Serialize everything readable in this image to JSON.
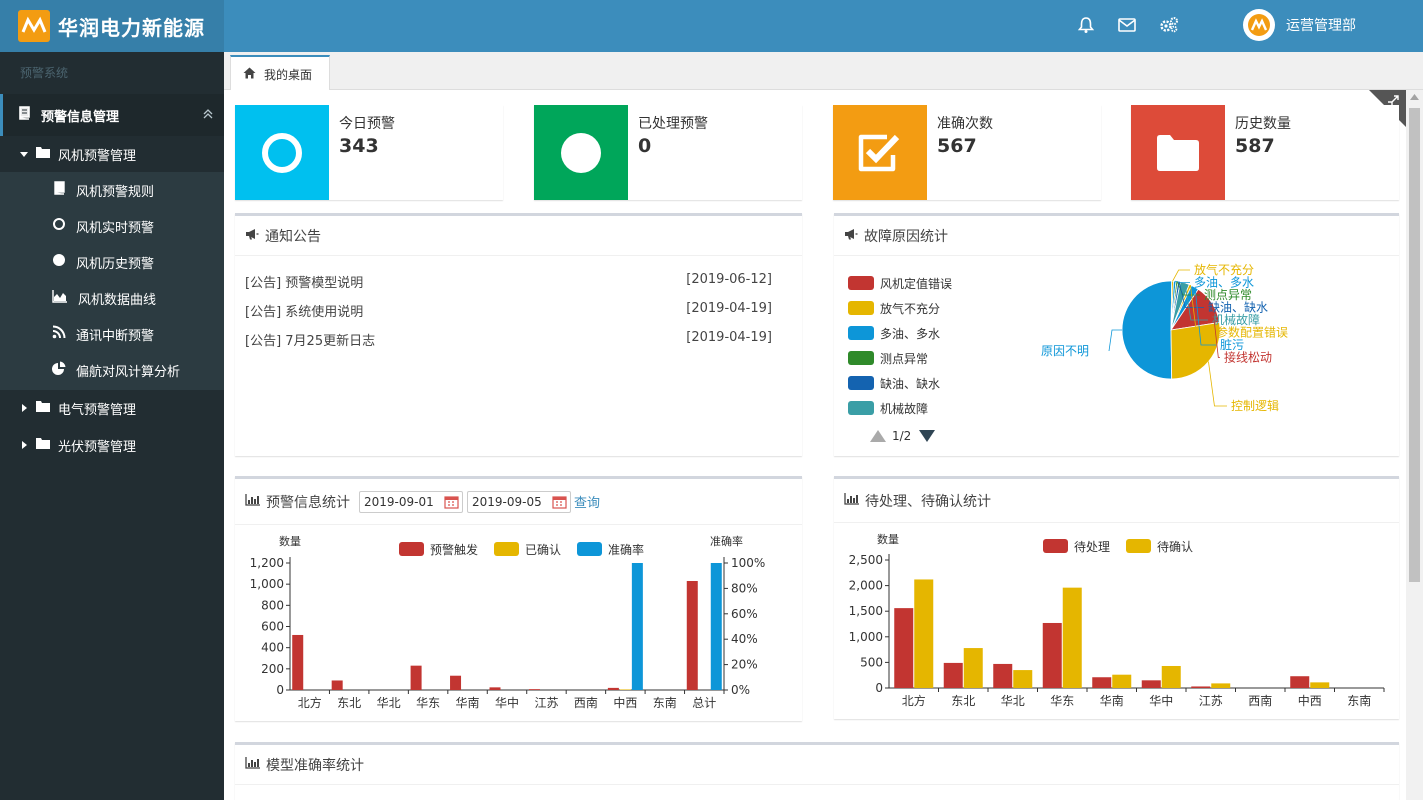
{
  "app": {
    "title": "华润电力新能源",
    "user": "运营管理部"
  },
  "topbar": {
    "icons": [
      "bell-icon",
      "envelope-icon",
      "gears-icon"
    ]
  },
  "sidebar": {
    "section_label": "预警系统",
    "root": {
      "label": "预警信息管理",
      "icon": "book-icon"
    },
    "groups": [
      {
        "label": "风机预警管理",
        "icon": "folder-icon",
        "expanded": true,
        "items": [
          {
            "label": "风机预警规则",
            "icon": "book-icon"
          },
          {
            "label": "风机实时预警",
            "icon": "circle-outline-icon"
          },
          {
            "label": "风机历史预警",
            "icon": "circle-icon"
          },
          {
            "label": "风机数据曲线",
            "icon": "area-chart-icon"
          },
          {
            "label": "通讯中断预警",
            "icon": "rss-icon"
          },
          {
            "label": "偏航对风计算分析",
            "icon": "pie-chart-icon"
          }
        ]
      },
      {
        "label": "电气预警管理",
        "icon": "folder-icon",
        "expanded": false
      },
      {
        "label": "光伏预警管理",
        "icon": "folder-icon",
        "expanded": false
      }
    ]
  },
  "tabs": [
    {
      "label": "我的桌面",
      "icon": "home-icon"
    }
  ],
  "stats": [
    {
      "title": "今日预警",
      "value": "343",
      "color": "#00c0ef",
      "icon": "circle-outline-icon"
    },
    {
      "title": "已处理预警",
      "value": "0",
      "color": "#00a65a",
      "icon": "circle-icon"
    },
    {
      "title": "准确次数",
      "value": "567",
      "color": "#f39c12",
      "icon": "check-square-icon"
    },
    {
      "title": "历史数量",
      "value": "587",
      "color": "#dd4b39",
      "icon": "folder-icon"
    }
  ],
  "notices": {
    "title": "通知公告",
    "items": [
      {
        "text": "[公告] 预警模型说明",
        "date": "[2019-06-12]"
      },
      {
        "text": "[公告] 系统使用说明",
        "date": "[2019-04-19]"
      },
      {
        "text": "[公告] 7月25更新日志",
        "date": "[2019-04-19]"
      }
    ]
  },
  "fault_panel": {
    "title": "故障原因统计",
    "legend": [
      {
        "name": "风机定值错误",
        "color": "#c23531"
      },
      {
        "name": "放气不充分",
        "color": "#e5b600"
      },
      {
        "name": "多油、多水",
        "color": "#0d96d8"
      },
      {
        "name": "测点异常",
        "color": "#2f8a2a"
      },
      {
        "name": "缺油、缺水",
        "color": "#1463b0"
      },
      {
        "name": "机械故障",
        "color": "#3a9ea6"
      }
    ],
    "pager": "1/2"
  },
  "warn_panel": {
    "title": "预警信息统计",
    "date_from": "2019-09-01",
    "date_to": "2019-09-05",
    "query": "查询"
  },
  "pending_panel": {
    "title": "待处理、待确认统计"
  },
  "model_panel": {
    "title": "模型准确率统计"
  },
  "chart_data": [
    {
      "type": "pie",
      "labels": [
        "原因不明",
        "放气不充分",
        "多油、多水",
        "测点异常",
        "缺油、缺水",
        "机械故障",
        "参数配置错误",
        "脏污",
        "接线松动",
        "控制逻辑"
      ],
      "values": [
        50,
        0.6,
        0.8,
        0.6,
        0.8,
        3,
        0.8,
        2.5,
        13,
        27
      ],
      "colors": [
        "#0d96d8",
        "#e5b600",
        "#0d96d8",
        "#2f8a2a",
        "#1463b0",
        "#3a9ea6",
        "#e5b600",
        "#0d96d8",
        "#c23531",
        "#e5b600"
      ]
    },
    {
      "type": "bar",
      "categories": [
        "北方",
        "东北",
        "华北",
        "华东",
        "华南",
        "华中",
        "江苏",
        "西南",
        "中西",
        "东南",
        "总计"
      ],
      "series": [
        {
          "name": "预警触发",
          "color": "#c23531",
          "values": [
            520,
            90,
            0,
            230,
            135,
            25,
            8,
            0,
            20,
            0,
            1030
          ]
        },
        {
          "name": "已确认",
          "color": "#e5b600",
          "values": [
            0,
            0,
            0,
            0,
            0,
            0,
            0,
            0,
            5,
            0,
            0
          ]
        },
        {
          "name": "准确率",
          "color": "#0d96d8",
          "axis": "right",
          "values": [
            0,
            0,
            0,
            0,
            0,
            0,
            0,
            0,
            100,
            0,
            100
          ]
        }
      ],
      "ylabel": "数量",
      "ylabel_right": "准确率",
      "ylim": [
        0,
        1200
      ],
      "yticks": [
        "0",
        "200",
        "400",
        "600",
        "800",
        "1,000",
        "1,200"
      ],
      "ylim_right": [
        0,
        100
      ],
      "yticks_right": [
        "0%",
        "20%",
        "40%",
        "60%",
        "80%",
        "100%"
      ]
    },
    {
      "type": "bar",
      "categories": [
        "北方",
        "东北",
        "华北",
        "华东",
        "华南",
        "华中",
        "江苏",
        "西南",
        "中西",
        "东南"
      ],
      "series": [
        {
          "name": "待处理",
          "color": "#c23531",
          "values": [
            1560,
            490,
            470,
            1270,
            210,
            150,
            30,
            0,
            230,
            0
          ]
        },
        {
          "name": "待确认",
          "color": "#e5b600",
          "values": [
            2120,
            780,
            350,
            1960,
            260,
            430,
            90,
            0,
            110,
            0
          ]
        }
      ],
      "ylabel": "数量",
      "ylim": [
        0,
        2500
      ],
      "yticks": [
        "0",
        "500",
        "1,000",
        "1,500",
        "2,000",
        "2,500"
      ]
    }
  ]
}
